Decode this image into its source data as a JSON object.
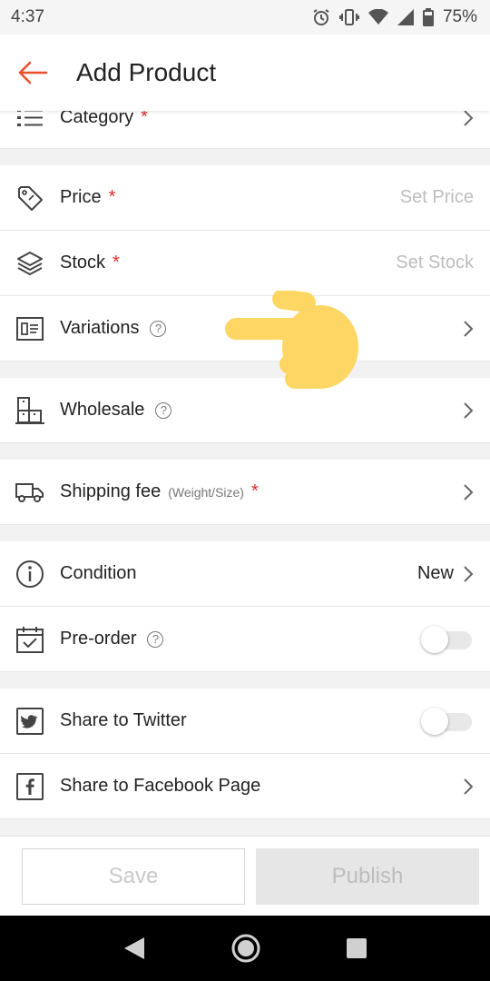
{
  "status_bar": {
    "time": "4:37",
    "battery": "75%"
  },
  "app_bar": {
    "title": "Add Product"
  },
  "rows": {
    "category": {
      "label": "Category",
      "required": "*"
    },
    "price": {
      "label": "Price",
      "required": "*",
      "placeholder": "Set Price"
    },
    "stock": {
      "label": "Stock",
      "required": "*",
      "placeholder": "Set Stock"
    },
    "variations": {
      "label": "Variations",
      "help": "?"
    },
    "wholesale": {
      "label": "Wholesale",
      "help": "?"
    },
    "shipping": {
      "label": "Shipping fee",
      "sub": "(Weight/Size)",
      "required": "*"
    },
    "condition": {
      "label": "Condition",
      "value": "New"
    },
    "preorder": {
      "label": "Pre-order",
      "help": "?",
      "enabled": false
    },
    "twitter": {
      "label": "Share to Twitter",
      "enabled": false
    },
    "facebook": {
      "label": "Share to Facebook Page"
    }
  },
  "footer": {
    "save_label": "Save",
    "publish_label": "Publish"
  },
  "colors": {
    "accent": "#ee4d2d",
    "required": "#e02a2a",
    "pointer": "#fdd663"
  },
  "icons": [
    "arrow-left-icon",
    "list-icon",
    "price-tag-icon",
    "layers-icon",
    "variations-icon",
    "wholesale-icon",
    "truck-icon",
    "info-icon",
    "calendar-check-icon",
    "twitter-icon",
    "facebook-icon",
    "chevron-right-icon",
    "pointing-hand-icon"
  ]
}
